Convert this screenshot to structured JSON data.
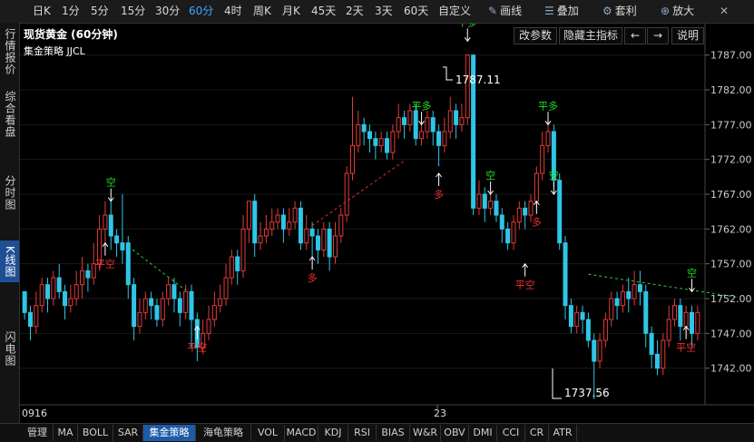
{
  "toolbar": {
    "periods": [
      "日K",
      "1分",
      "5分",
      "15分",
      "30分",
      "60分",
      "4时",
      "周K",
      "月K",
      "45天",
      "2天",
      "3天",
      "60天",
      "自定义"
    ],
    "active_period": "60分",
    "draw_label": "画线",
    "overlay_label": "叠加",
    "arbitrage_label": "套利",
    "zoom_label": "放大"
  },
  "side_tabs": [
    "行情报价",
    "综合看盘",
    "分时图",
    "K线图",
    "闪电图"
  ],
  "active_side_tab": "K线图",
  "chart": {
    "title": "现货黄金 (60分钟)",
    "strategy": "集金策略 JJCL",
    "buttons": {
      "params": "改参数",
      "hide": "隐藏主指标",
      "prev": "←",
      "next": "→",
      "help": "说明"
    },
    "y_ticks": [
      "1787.00",
      "1782.00",
      "1777.00",
      "1772.00",
      "1767.00",
      "1762.00",
      "1757.00",
      "1752.00",
      "1747.00",
      "1742.00"
    ],
    "x_labels": [
      "0916",
      "23"
    ],
    "high_label": "1787.11",
    "low_label": "1737.56"
  },
  "chart_data": {
    "type": "candlestick",
    "ylim": [
      1737.0,
      1791.0
    ],
    "candles": [
      [
        1753,
        1750,
        1749,
        1751
      ],
      [
        1750,
        1748,
        1746,
        1751
      ],
      [
        1748,
        1751,
        1747,
        1753
      ],
      [
        1751,
        1754,
        1750,
        1755
      ],
      [
        1754,
        1752,
        1750,
        1755
      ],
      [
        1752,
        1755,
        1751,
        1756
      ],
      [
        1755,
        1753,
        1752,
        1757
      ],
      [
        1753,
        1751,
        1749,
        1754
      ],
      [
        1751,
        1752,
        1750,
        1754
      ],
      [
        1752,
        1754,
        1751,
        1756
      ],
      [
        1754,
        1756,
        1752,
        1758
      ],
      [
        1756,
        1755,
        1753,
        1757
      ],
      [
        1755,
        1757,
        1754,
        1760
      ],
      [
        1757,
        1762,
        1756,
        1764
      ],
      [
        1762,
        1764,
        1760,
        1766
      ],
      [
        1764,
        1761,
        1759,
        1766
      ],
      [
        1761,
        1760,
        1758,
        1762
      ],
      [
        1760,
        1759,
        1757,
        1767
      ],
      [
        1760,
        1754,
        1752,
        1761
      ],
      [
        1754,
        1748,
        1746,
        1755
      ],
      [
        1748,
        1750,
        1747,
        1752
      ],
      [
        1750,
        1752,
        1749,
        1753
      ],
      [
        1752,
        1751,
        1749,
        1753
      ],
      [
        1751,
        1749,
        1748,
        1752
      ],
      [
        1749,
        1752,
        1748,
        1753
      ],
      [
        1752,
        1754,
        1751,
        1755
      ],
      [
        1754,
        1752,
        1750,
        1755
      ],
      [
        1752,
        1750,
        1748,
        1753
      ],
      [
        1750,
        1753,
        1749,
        1754
      ],
      [
        1753,
        1749,
        1745,
        1754
      ],
      [
        1749,
        1745,
        1743,
        1750
      ],
      [
        1745,
        1747,
        1744,
        1749
      ],
      [
        1747,
        1749,
        1746,
        1751
      ],
      [
        1749,
        1751,
        1748,
        1753
      ],
      [
        1751,
        1752,
        1750,
        1754
      ],
      [
        1752,
        1755,
        1751,
        1757
      ],
      [
        1755,
        1758,
        1754,
        1759
      ],
      [
        1758,
        1756,
        1754,
        1759
      ],
      [
        1756,
        1762,
        1755,
        1764
      ],
      [
        1762,
        1766,
        1760,
        1766
      ],
      [
        1766,
        1760,
        1758,
        1767
      ],
      [
        1760,
        1761,
        1759,
        1763
      ],
      [
        1761,
        1762,
        1760,
        1764
      ],
      [
        1762,
        1763,
        1761,
        1765
      ],
      [
        1763,
        1764,
        1762,
        1765
      ],
      [
        1764,
        1762,
        1760,
        1765
      ],
      [
        1762,
        1763,
        1761,
        1765
      ],
      [
        1763,
        1765,
        1762,
        1766
      ],
      [
        1765,
        1760,
        1759,
        1766
      ],
      [
        1760,
        1762,
        1759,
        1764
      ],
      [
        1762,
        1761,
        1758,
        1763
      ],
      [
        1761,
        1759,
        1757,
        1762
      ],
      [
        1759,
        1762,
        1758,
        1763
      ],
      [
        1762,
        1758,
        1756,
        1763
      ],
      [
        1758,
        1761,
        1757,
        1763
      ],
      [
        1761,
        1764,
        1760,
        1765
      ],
      [
        1764,
        1770,
        1763,
        1771
      ],
      [
        1770,
        1774,
        1769,
        1781
      ],
      [
        1774,
        1777,
        1773,
        1779
      ],
      [
        1777,
        1776,
        1774,
        1778
      ],
      [
        1776,
        1775,
        1773,
        1777
      ],
      [
        1775,
        1774,
        1772,
        1776
      ],
      [
        1774,
        1775,
        1773,
        1776
      ],
      [
        1775,
        1773,
        1772,
        1776
      ],
      [
        1773,
        1776,
        1772,
        1777
      ],
      [
        1776,
        1778,
        1775,
        1780
      ],
      [
        1778,
        1777,
        1775,
        1779
      ],
      [
        1777,
        1779,
        1776,
        1780
      ],
      [
        1779,
        1775,
        1774,
        1780
      ],
      [
        1775,
        1776,
        1774,
        1777
      ],
      [
        1776,
        1778,
        1775,
        1779
      ],
      [
        1778,
        1776,
        1774,
        1779
      ],
      [
        1776,
        1774,
        1771,
        1777
      ],
      [
        1774,
        1776,
        1773,
        1778
      ],
      [
        1776,
        1779,
        1775,
        1781
      ],
      [
        1779,
        1777,
        1775,
        1780
      ],
      [
        1777,
        1778,
        1776,
        1780
      ],
      [
        1778,
        1787,
        1777,
        1787.11
      ],
      [
        1787,
        1765,
        1764,
        1787
      ],
      [
        1765,
        1767,
        1764,
        1769
      ],
      [
        1767,
        1765,
        1763,
        1768
      ],
      [
        1765,
        1766,
        1764,
        1767
      ],
      [
        1766,
        1764,
        1763,
        1767
      ],
      [
        1764,
        1762,
        1760,
        1765
      ],
      [
        1762,
        1760,
        1759,
        1763
      ],
      [
        1760,
        1763,
        1759,
        1764
      ],
      [
        1763,
        1765,
        1762,
        1766
      ],
      [
        1765,
        1764,
        1762,
        1766
      ],
      [
        1764,
        1766,
        1763,
        1767
      ],
      [
        1766,
        1770,
        1765,
        1771
      ],
      [
        1770,
        1774,
        1769,
        1776
      ],
      [
        1774,
        1776,
        1773,
        1777
      ],
      [
        1776,
        1769,
        1768,
        1777
      ],
      [
        1769,
        1760,
        1759,
        1770
      ],
      [
        1760,
        1751,
        1749,
        1761
      ],
      [
        1751,
        1748,
        1747,
        1752
      ],
      [
        1748,
        1750,
        1747,
        1751
      ],
      [
        1750,
        1749,
        1747,
        1751
      ],
      [
        1749,
        1746,
        1745,
        1750
      ],
      [
        1746,
        1743,
        1737.56,
        1747
      ],
      [
        1743,
        1746,
        1742,
        1747
      ],
      [
        1746,
        1749,
        1745,
        1750
      ],
      [
        1749,
        1752,
        1748,
        1753
      ],
      [
        1752,
        1751,
        1749,
        1753
      ],
      [
        1751,
        1753,
        1750,
        1754
      ],
      [
        1753,
        1752,
        1750,
        1755
      ],
      [
        1752,
        1754,
        1751,
        1756
      ],
      [
        1754,
        1753,
        1751,
        1756
      ],
      [
        1753,
        1747,
        1745,
        1754
      ],
      [
        1747,
        1744,
        1742,
        1748
      ],
      [
        1744,
        1742,
        1741,
        1746
      ],
      [
        1742,
        1746,
        1741,
        1747
      ],
      [
        1746,
        1749,
        1745,
        1751
      ],
      [
        1749,
        1751,
        1748,
        1752
      ],
      [
        1751,
        1748,
        1746,
        1752
      ],
      [
        1748,
        1750,
        1747,
        1751
      ],
      [
        1750,
        1747,
        1745,
        1751
      ],
      [
        1747,
        1750,
        1746,
        1751
      ]
    ],
    "dashed_lines": [
      {
        "from": [
          18,
          1759.5
        ],
        "to": [
          28,
          1753.2
        ],
        "color": "#2ecc40"
      },
      {
        "from": [
          50,
          1762.5
        ],
        "to": [
          66,
          1771.8
        ],
        "color": "#e03030"
      },
      {
        "from": [
          98,
          1755.5
        ],
        "to": [
          124,
          1752.2
        ],
        "color": "#2ecc40"
      }
    ],
    "signals": [
      {
        "i": 15,
        "label": "空",
        "color": "#22dd22",
        "pos": "above",
        "arrow": "down",
        "at": 1766
      },
      {
        "i": 14,
        "label": "平空",
        "color": "#ee3030",
        "pos": "below",
        "arrow": "up",
        "at": 1760
      },
      {
        "i": 30,
        "label": "平空",
        "color": "#ee3030",
        "pos": "below",
        "arrow": "up",
        "at": 1748
      },
      {
        "i": 50,
        "label": "多",
        "color": "#ee3030",
        "pos": "below",
        "arrow": "up",
        "at": 1758
      },
      {
        "i": 69,
        "label": "平多",
        "color": "#22dd22",
        "pos": "above",
        "arrow": "down",
        "at": 1777
      },
      {
        "i": 72,
        "label": "多",
        "color": "#ee3030",
        "pos": "below",
        "arrow": "up",
        "at": 1770
      },
      {
        "i": 77,
        "label": "平多",
        "color": "#22dd22",
        "pos": "above",
        "arrow": "down",
        "at": 1789
      },
      {
        "i": 81,
        "label": "空",
        "color": "#22dd22",
        "pos": "above",
        "arrow": "down",
        "at": 1767
      },
      {
        "i": 87,
        "label": "平空",
        "color": "#ee3030",
        "pos": "below",
        "arrow": "up",
        "at": 1757
      },
      {
        "i": 89,
        "label": "多",
        "color": "#ee3030",
        "pos": "below",
        "arrow": "up",
        "at": 1766
      },
      {
        "i": 91,
        "label": "平多",
        "color": "#22dd22",
        "pos": "above",
        "arrow": "down",
        "at": 1777
      },
      {
        "i": 92,
        "label": "空",
        "color": "#22dd22",
        "pos": "above",
        "arrow": "down",
        "at": 1767
      },
      {
        "i": 116,
        "label": "空",
        "color": "#22dd22",
        "pos": "above",
        "arrow": "down",
        "at": 1753
      },
      {
        "i": 115,
        "label": "平空",
        "color": "#ee3030",
        "pos": "below",
        "arrow": "up",
        "at": 1748
      }
    ]
  },
  "bottom_tabs": [
    "管理",
    "MA",
    "BOLL",
    "SAR",
    "集金策略",
    "海龟策略",
    "VOL",
    "MACD",
    "KDJ",
    "RSI",
    "BIAS",
    "W&R",
    "OBV",
    "DMI",
    "CCI",
    "CR",
    "ATR"
  ],
  "active_bottom_tab": "集金策略"
}
